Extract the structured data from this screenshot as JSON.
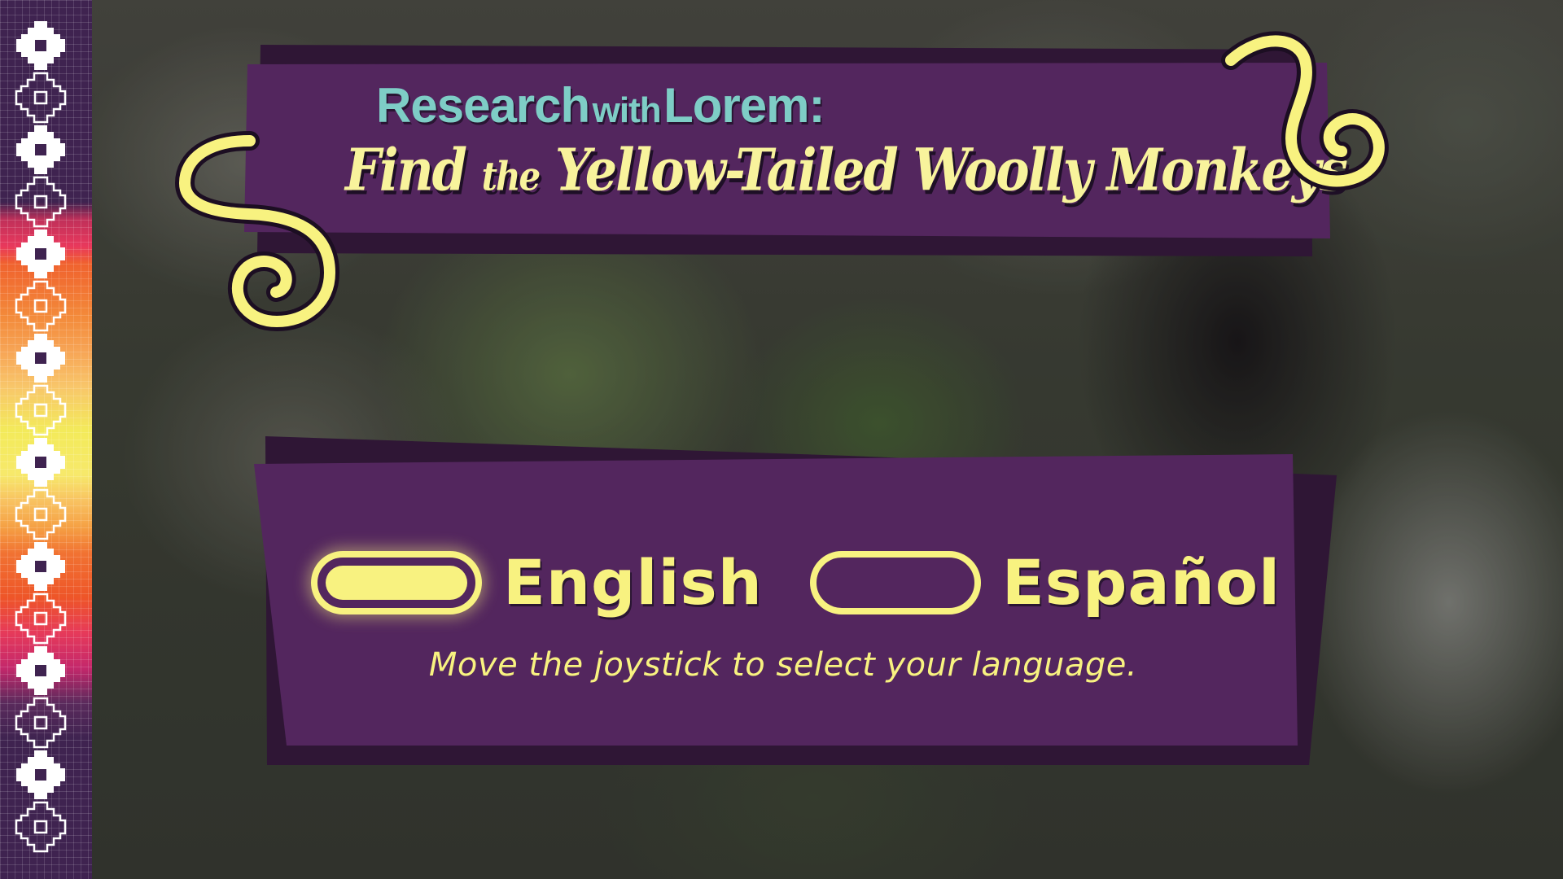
{
  "title": {
    "line1_research": "Research",
    "line1_with": "with",
    "line1_lorem": "Lorem:",
    "line2_find": "Find",
    "line2_the": "the",
    "line2_rest": "Yellow-Tailed Woolly Monkeys"
  },
  "language_select": {
    "options": [
      {
        "label": "English",
        "selected": true
      },
      {
        "label": "Español",
        "selected": false
      }
    ],
    "instruction": "Move the joystick to select your language."
  },
  "colors": {
    "panel_purple": "#53265e",
    "panel_shadow": "#2f1635",
    "accent_yellow": "#f8f280",
    "title_teal": "#7ecdc6"
  },
  "icons": [
    "woven-motif-icon",
    "spiral-swirl-icon"
  ]
}
